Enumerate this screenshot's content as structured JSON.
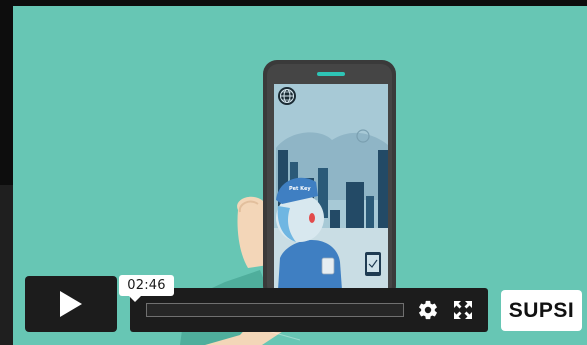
{
  "player": {
    "current_time": "02:46",
    "progress": 0.0
  },
  "branding": {
    "logo_text": "SUPSI"
  },
  "scene": {
    "cap_text": "Pet Key"
  },
  "colors": {
    "video_background": "#67c6b4",
    "controls_background": "#1c1c1c",
    "phone_body": "#3a3a3a",
    "phone_screen": "#a7c9d6",
    "accent_teal": "#2ec4b6"
  },
  "icons": {
    "play": "play-icon",
    "settings": "gear-icon",
    "fullscreen": "fullscreen-icon",
    "globe": "globe-icon"
  }
}
